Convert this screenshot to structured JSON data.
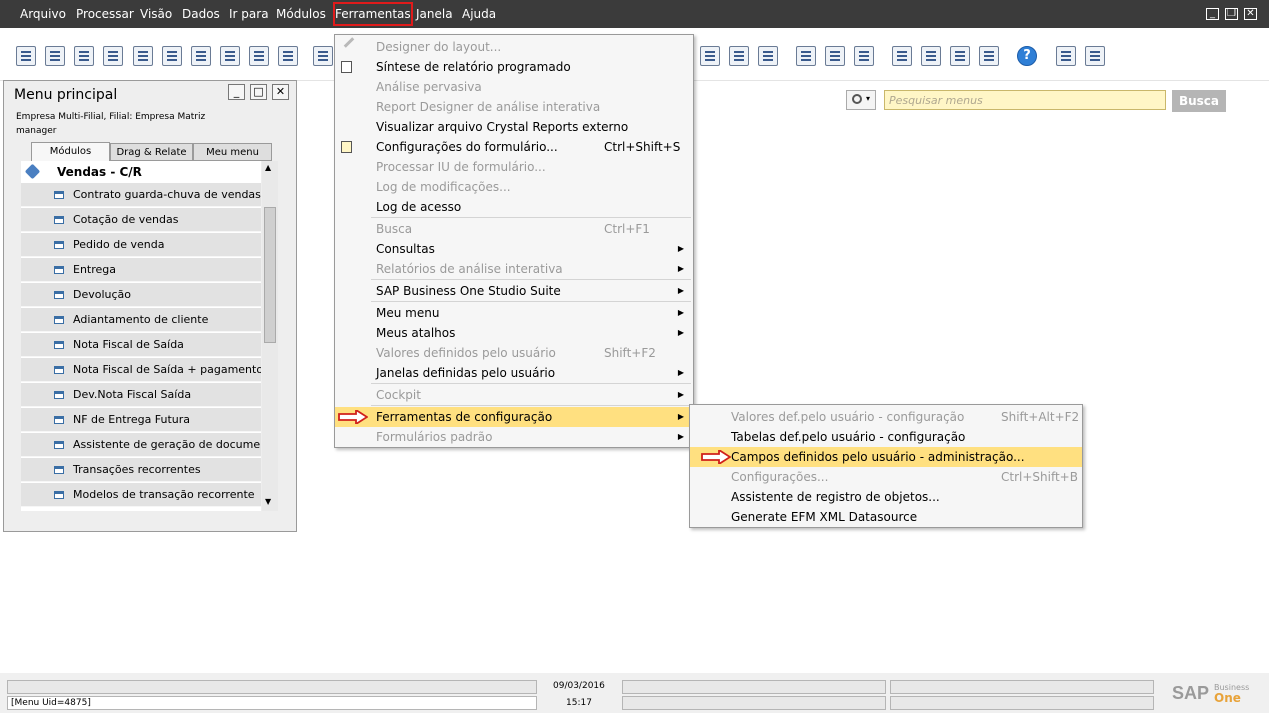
{
  "menubar": {
    "items": [
      "Arquivo",
      "Processar",
      "Visão",
      "Dados",
      "Ir para",
      "Módulos",
      "Ferramentas",
      "Janela",
      "Ajuda"
    ],
    "active": "Ferramentas"
  },
  "search": {
    "placeholder": "Pesquisar menus",
    "button": "Busca"
  },
  "main_menu": {
    "title": "Menu principal",
    "company_line1": "Empresa Multi-Filial, Filial: Empresa Matriz",
    "company_line2": "manager",
    "tabs": [
      "Módulos",
      "Drag & Relate",
      "Meu menu"
    ],
    "section": "Vendas - C/R",
    "items": [
      "Contrato guarda-chuva de vendas",
      "Cotação de vendas",
      "Pedido de venda",
      "Entrega",
      "Devolução",
      "Adiantamento de cliente",
      "Nota Fiscal de Saída",
      "Nota Fiscal de Saída + pagamento",
      "Dev.Nota Fiscal Saída",
      "NF de Entrega Futura",
      "Assistente de geração de documentos",
      "Transações recorrentes",
      "Modelos de transação recorrente"
    ]
  },
  "tools_menu": {
    "items": [
      {
        "label": "Designer do layout...",
        "shortcut": "",
        "disabled": true,
        "submenu": false
      },
      {
        "label": "Síntese de relatório programado",
        "shortcut": "",
        "disabled": false,
        "submenu": false
      },
      {
        "label": "Análise pervasiva",
        "shortcut": "",
        "disabled": true,
        "submenu": false
      },
      {
        "label": "Report Designer de análise interativa",
        "shortcut": "",
        "disabled": true,
        "submenu": false
      },
      {
        "label": "Visualizar arquivo Crystal Reports externo",
        "shortcut": "",
        "disabled": false,
        "submenu": false
      },
      {
        "label": "Configurações do formulário...",
        "shortcut": "Ctrl+Shift+S",
        "disabled": false,
        "submenu": false
      },
      {
        "label": "Processar IU de formulário...",
        "shortcut": "",
        "disabled": true,
        "submenu": false
      },
      {
        "label": "Log de modificações...",
        "shortcut": "",
        "disabled": true,
        "submenu": false
      },
      {
        "label": "Log de acesso",
        "shortcut": "",
        "disabled": false,
        "submenu": false
      },
      {
        "label": "Busca",
        "shortcut": "Ctrl+F1",
        "disabled": true,
        "submenu": false
      },
      {
        "label": "Consultas",
        "shortcut": "",
        "disabled": false,
        "submenu": true
      },
      {
        "label": "Relatórios de análise interativa",
        "shortcut": "",
        "disabled": true,
        "submenu": true
      },
      {
        "label": "SAP Business One Studio Suite",
        "shortcut": "",
        "disabled": false,
        "submenu": true
      },
      {
        "label": "Meu menu",
        "shortcut": "",
        "disabled": false,
        "submenu": true
      },
      {
        "label": "Meus atalhos",
        "shortcut": "",
        "disabled": false,
        "submenu": true
      },
      {
        "label": "Valores definidos pelo usuário",
        "shortcut": "Shift+F2",
        "disabled": true,
        "submenu": false
      },
      {
        "label": "Janelas definidas pelo usuário",
        "shortcut": "",
        "disabled": false,
        "submenu": true
      },
      {
        "label": "Cockpit",
        "shortcut": "",
        "disabled": true,
        "submenu": true
      },
      {
        "label": "Ferramentas de configuração",
        "shortcut": "",
        "disabled": false,
        "submenu": true,
        "highlighted": true
      },
      {
        "label": "Formulários padrão",
        "shortcut": "",
        "disabled": true,
        "submenu": true
      }
    ]
  },
  "config_submenu": {
    "items": [
      {
        "label": "Valores def.pelo usuário - configuração",
        "shortcut": "Shift+Alt+F2",
        "disabled": true
      },
      {
        "label": "Tabelas def.pelo usuário - configuração",
        "shortcut": "",
        "disabled": false
      },
      {
        "label": "Campos definidos pelo usuário - administração...",
        "shortcut": "",
        "disabled": false,
        "highlighted": true
      },
      {
        "label": "Configurações...",
        "shortcut": "Ctrl+Shift+B",
        "disabled": true
      },
      {
        "label": "Assistente de registro de objetos...",
        "shortcut": "",
        "disabled": false
      },
      {
        "label": "Generate EFM XML Datasource",
        "shortcut": "",
        "disabled": false
      }
    ]
  },
  "status": {
    "menu_uid": "[Menu Uid=4875]",
    "date": "09/03/2016",
    "time": "15:17",
    "logo_main": "SAP",
    "logo_sub1": "Business",
    "logo_sub2": "One"
  },
  "colors": {
    "menubar_bg": "#3b3b3b",
    "highlight": "#ffe080",
    "active_outline": "#e01b1b",
    "search_bg": "#fff6c6"
  }
}
